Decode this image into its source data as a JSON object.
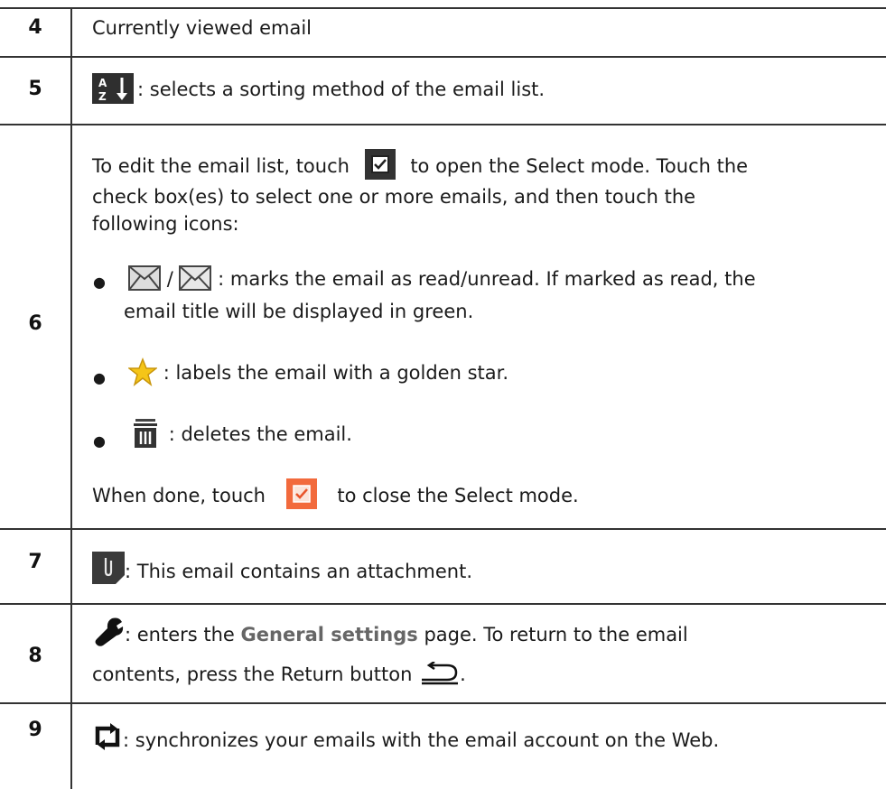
{
  "rows": [
    {
      "num": "4",
      "text": "Currently viewed email"
    },
    {
      "num": "5",
      "text": ": selects a sorting method of the email list."
    },
    {
      "num": "6",
      "intro1a": "To edit the email list, touch",
      "intro1b": "to open the Select mode. Touch the",
      "intro2": "check box(es) to select one or more emails, and then touch the",
      "intro3": "following icons:",
      "bullet1a": ": marks the email as read/unread. If marked as read, the",
      "bullet1b": "email title will be displayed in green.",
      "bullet1_sep": "/",
      "bullet2": ": labels the email with a golden star.",
      "bullet3": ": deletes the email.",
      "closing_a": "When done, touch",
      "closing_b": "to close the Select mode."
    },
    {
      "num": "7",
      "text": ": This email contains an attachment."
    },
    {
      "num": "8",
      "line1_a": ": enters the",
      "line1_b": "General settings",
      "line1_c": "page. To return to the email",
      "line2_a": "contents, press the Return button",
      "line2_b": "."
    },
    {
      "num": "9",
      "text": ": synchronizes your emails with the email account on the Web."
    }
  ],
  "bullet_char": "●"
}
